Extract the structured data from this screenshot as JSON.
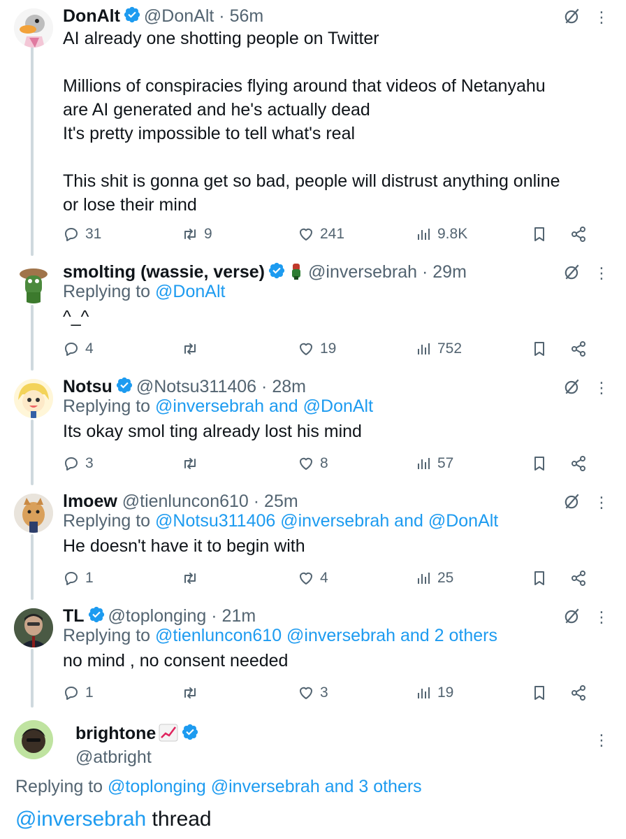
{
  "colors": {
    "link": "#1d9bf0",
    "muted": "#536471",
    "text": "#0f1419",
    "line": "#cfd9de"
  },
  "tweets": [
    {
      "name": "DonAlt",
      "handle": "@DonAlt",
      "time": "· 56m",
      "text": "AI already one shotting people on Twitter\n\nMillions of conspiracies flying around that videos of Netanyahu\nare AI generated and he's actually dead\nIt's pretty impossible to tell what's real\n\nThis shit is gonna get so bad, people will distrust anything online\nor lose their mind",
      "replies": "31",
      "retweets": "9",
      "likes": "241",
      "views": "9.8K"
    },
    {
      "name": "smolting (wassie, verse)",
      "handle": "@inversebrah",
      "time": "· 29m",
      "reply_prefix": "Replying to",
      "reply_to": "@DonAlt",
      "text": "^_^",
      "replies": "4",
      "retweets": "",
      "likes": "19",
      "views": "752"
    },
    {
      "name": "Notsu",
      "handle": "@Notsu311406",
      "time": "· 28m",
      "reply_prefix": "Replying to",
      "reply_to": "@inversebrah and @DonAlt",
      "text": "Its okay smol ting already lost his mind",
      "replies": "3",
      "retweets": "",
      "likes": "8",
      "views": "57"
    },
    {
      "name": "lmoew",
      "handle": "@tienluncon610",
      "time": "· 25m",
      "reply_prefix": "Replying to",
      "reply_to": "@Notsu311406 @inversebrah and @DonAlt",
      "text": "He doesn't have it to begin with",
      "replies": "1",
      "retweets": "",
      "likes": "4",
      "views": "25"
    },
    {
      "name": "TL",
      "handle": "@toplonging",
      "time": "· 21m",
      "reply_prefix": "Replying to",
      "reply_to": "@tienluncon610 @inversebrah and 2 others",
      "text": "no mind , no consent needed",
      "replies": "1",
      "retweets": "",
      "likes": "3",
      "views": "19"
    }
  ],
  "main_tweet": {
    "name": "brightone",
    "handle": "@atbright",
    "reply_prefix": "Replying to",
    "reply_to": "@toplonging @inversebrah and 3 others",
    "mention": "@inversebrah",
    "text": " thread"
  }
}
